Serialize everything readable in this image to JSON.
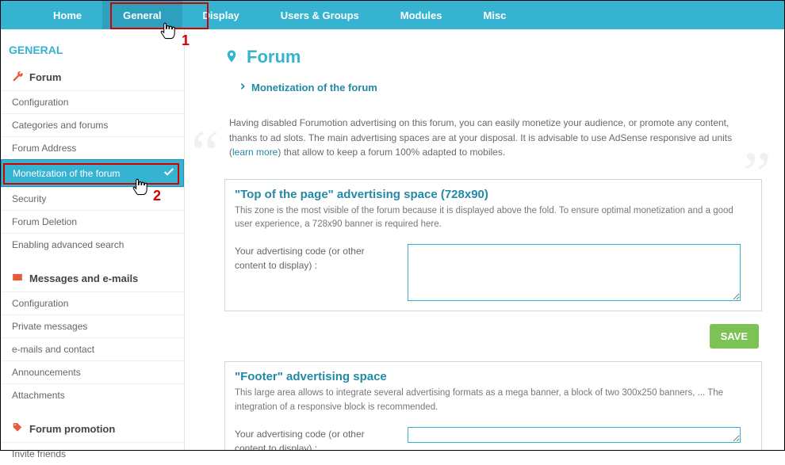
{
  "topnav": {
    "items": [
      {
        "label": "Home"
      },
      {
        "label": "General"
      },
      {
        "label": "Display"
      },
      {
        "label": "Users & Groups"
      },
      {
        "label": "Modules"
      },
      {
        "label": "Misc"
      }
    ]
  },
  "sidebar": {
    "title": "GENERAL",
    "sections": [
      {
        "header": "Forum",
        "items": [
          {
            "label": "Configuration"
          },
          {
            "label": "Categories and forums"
          },
          {
            "label": "Forum Address"
          },
          {
            "label": "Monetization of the forum"
          },
          {
            "label": "Security"
          },
          {
            "label": "Forum Deletion"
          },
          {
            "label": "Enabling advanced search"
          }
        ]
      },
      {
        "header": "Messages and e-mails",
        "items": [
          {
            "label": "Configuration"
          },
          {
            "label": "Private messages"
          },
          {
            "label": "e-mails and contact"
          },
          {
            "label": "Announcements"
          },
          {
            "label": "Attachments"
          }
        ]
      },
      {
        "header": "Forum promotion",
        "items": [
          {
            "label": "Invite friends"
          }
        ]
      }
    ]
  },
  "main": {
    "page_title": "Forum",
    "breadcrumb_label": "Monetization of the forum",
    "intro_pre": "Having disabled Forumotion advertising on this forum, you can easily monetize your audience, or promote any content, thanks to ad slots. The main advertising spaces are at your disposal. It is advisable to use AdSense responsive ad units (",
    "intro_link": "learn more",
    "intro_post": ") that allow to keep a forum 100% adapted to mobiles.",
    "panels": [
      {
        "title": "\"Top of the page\" advertising space (728x90)",
        "desc": "This zone is the most visible of the forum because it is displayed above the fold. To ensure optimal monetization and a good user experience, a 728x90 banner is required here.",
        "field_label": "Your advertising code (or other content to display) :"
      },
      {
        "title": "\"Footer\" advertising space",
        "desc": "This large area allows to integrate several advertising formats as a mega banner, a block of two 300x250 banners, ... The integration of a responsive block is recommended.",
        "field_label": "Your advertising code (or other content to display) :"
      }
    ],
    "save_label": "SAVE"
  },
  "annotations": {
    "num1": "1",
    "num2": "2"
  }
}
